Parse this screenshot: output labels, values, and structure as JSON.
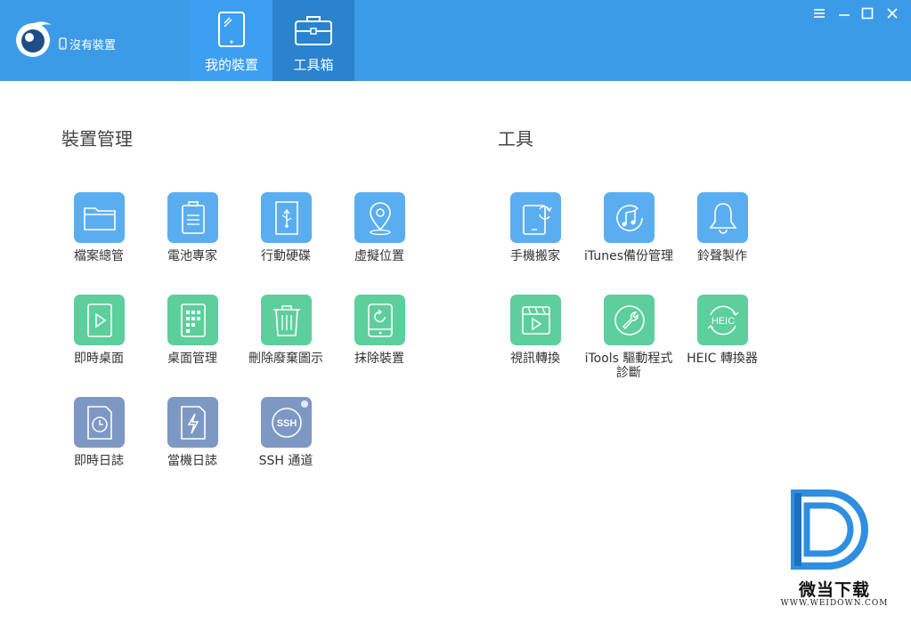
{
  "header": {
    "device_status": "沒有裝置",
    "tabs": [
      {
        "label": "我的裝置",
        "icon": "tablet-icon",
        "active": false
      },
      {
        "label": "工具箱",
        "icon": "toolbox-icon",
        "active": true
      }
    ],
    "window_controls": [
      "menu-icon",
      "minimize-icon",
      "maximize-icon",
      "close-icon"
    ]
  },
  "colors": {
    "header": "#3c9be7",
    "tab_active": "#2a83cc",
    "tile_blue": "#5aaef0",
    "tile_green": "#5ccf9c",
    "tile_slate": "#7e98c4"
  },
  "device_management": {
    "title": "裝置管理",
    "items": [
      {
        "label": "檔案總管",
        "icon": "folder-icon",
        "color": "#5aaef0"
      },
      {
        "label": "電池專家",
        "icon": "battery-icon",
        "color": "#5aaef0"
      },
      {
        "label": "行動硬碟",
        "icon": "usb-drive-icon",
        "color": "#5aaef0"
      },
      {
        "label": "虛擬位置",
        "icon": "location-pin-icon",
        "color": "#5aaef0"
      },
      {
        "label": "即時桌面",
        "icon": "play-screen-icon",
        "color": "#5ccf9c"
      },
      {
        "label": "桌面管理",
        "icon": "app-grid-icon",
        "color": "#5ccf9c"
      },
      {
        "label": "刪除廢棄圖示",
        "icon": "trash-icon",
        "color": "#5ccf9c"
      },
      {
        "label": "抹除裝置",
        "icon": "erase-device-icon",
        "color": "#5ccf9c"
      },
      {
        "label": "即時日誌",
        "icon": "clock-log-icon",
        "color": "#7e98c4"
      },
      {
        "label": "當機日誌",
        "icon": "crash-log-icon",
        "color": "#7e98c4"
      },
      {
        "label": "SSH 通道",
        "icon": "ssh-icon",
        "icon_text": "SSH",
        "color": "#7e98c4"
      }
    ]
  },
  "tools": {
    "title": "工具",
    "items": [
      {
        "label": "手機搬家",
        "icon": "phone-transfer-icon",
        "color": "#5aaef0"
      },
      {
        "label": "iTunes備份管理",
        "icon": "music-note-icon",
        "color": "#5aaef0"
      },
      {
        "label": "鈴聲製作",
        "icon": "bell-icon",
        "color": "#5aaef0"
      },
      {
        "label": "視訊轉換",
        "icon": "video-icon",
        "color": "#5ccf9c"
      },
      {
        "label": "iTools 驅動程式診斷",
        "icon": "wrench-icon",
        "color": "#5ccf9c"
      },
      {
        "label": "HEIC 轉換器",
        "icon": "heic-icon",
        "icon_text": "HEIC",
        "color": "#5ccf9c"
      }
    ]
  },
  "watermark": {
    "name": "微当下载",
    "url": "WWW.WEIDOWN.COM"
  }
}
